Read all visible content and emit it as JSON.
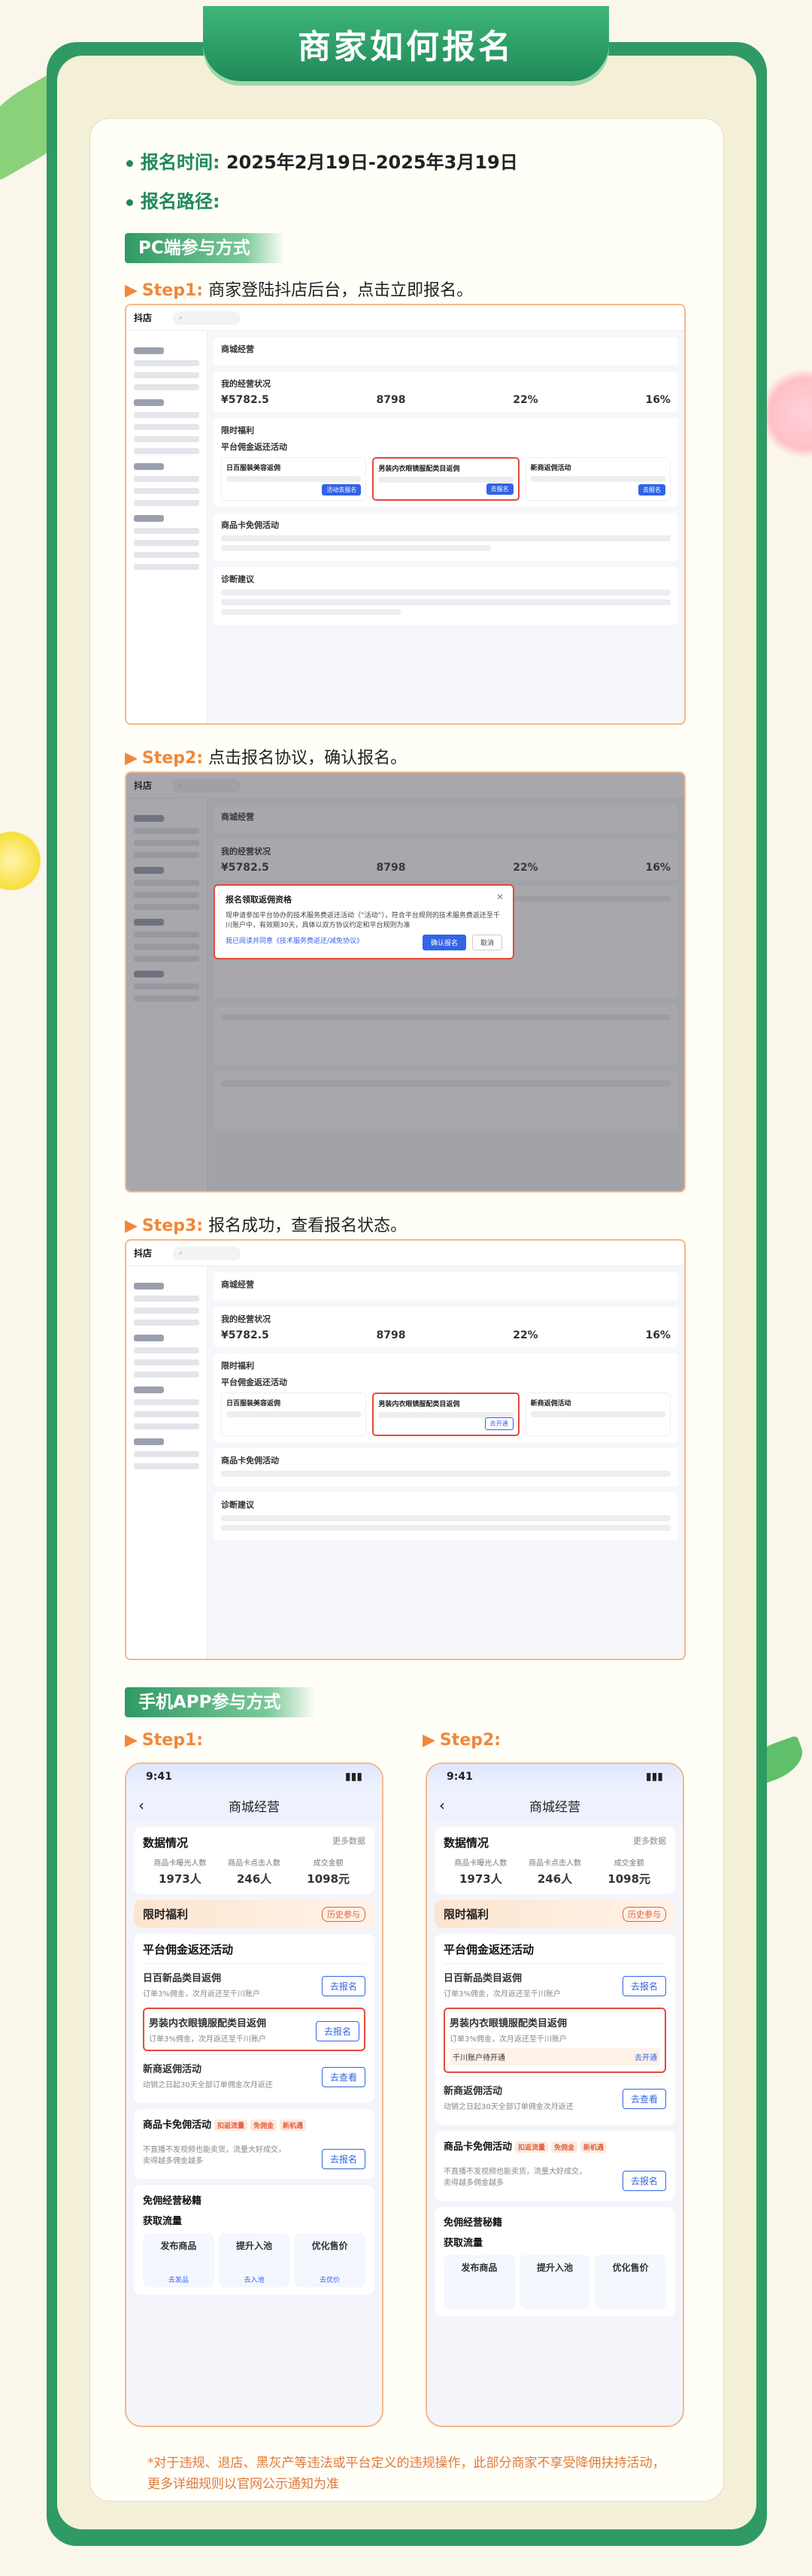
{
  "title": "商家如何报名",
  "info": {
    "time_label": "报名时间:",
    "time_value": "2025年2月19日-2025年3月19日",
    "path_label": "报名路径:"
  },
  "pc": {
    "tag": "PC端参与方式",
    "steps": [
      {
        "label": "Step1:",
        "text": "商家登陆抖店后台，点击立即报名。"
      },
      {
        "label": "Step2:",
        "text": "点击报名协议，确认报名。"
      },
      {
        "label": "Step3:",
        "text": "报名成功，查看报名状态。"
      }
    ],
    "screen": {
      "logo": "抖店",
      "page_title": "商城经营",
      "card1_title": "我的经营状况",
      "kpis": [
        "¥5782.5",
        "8798",
        "22%",
        "16%"
      ],
      "card2_title": "限时福利",
      "sub_title": "平台佣金返还活动",
      "activities": [
        {
          "name": "日百服装美容返佣",
          "btn": "活动去报名"
        },
        {
          "name": "男装内衣眼镜服配类目返佣",
          "btn": "去报名"
        },
        {
          "name": "新商返佣活动",
          "btn": "去报名"
        }
      ],
      "card3_title": "商品卡免佣活动",
      "card4_title": "诊断建议"
    },
    "modal": {
      "title": "报名领取返佣资格",
      "body": "现申请参加平台协办的技术服务费返还活动（“活动”），符合平台规则的技术服务费返还至千川账户中，有效期30天，具体以双方协议约定和平台规则为准",
      "agree": "我已阅读并同意《技术服务费返还/减免协议》",
      "ok": "确认报名",
      "cancel": "取消"
    }
  },
  "app": {
    "tag": "手机APP参与方式",
    "step1": "Step1:",
    "step2": "Step2:",
    "time": "9:41",
    "nav_title": "商城经营",
    "stats_title": "数据情况",
    "stats_more": "更多数据",
    "stats": [
      {
        "label": "商品卡曝光人数",
        "value": "1973人"
      },
      {
        "label": "商品卡点击人数",
        "value": "246人"
      },
      {
        "label": "成交金额",
        "value": "1098元"
      }
    ],
    "welfare": "限时福利",
    "history": "历史参与",
    "section": "平台佣金返还活动",
    "items": [
      {
        "name": "日百新品类目返佣",
        "desc": "订单3%佣金，次月返还至千川账户",
        "btn": "去报名"
      },
      {
        "name": "男装内衣眼镜服配类目返佣",
        "desc": "订单3%佣金，次月返还至千川账户",
        "btn": "去报名"
      },
      {
        "name": "新商返佣活动",
        "desc": "动销之日起30天全部订单佣金次月返还",
        "btn": "去查看"
      }
    ],
    "step2_hint": "千川账户待开通",
    "step2_link": "去开通",
    "free_title": "商品卡免佣活动",
    "free_tags": [
      "扣返流量",
      "免佣金",
      "新机遇"
    ],
    "free_desc": "不直播不发视频也能卖货，流量大好成交，卖得越多佣金越多",
    "free_btn": "去报名",
    "secret": "免佣经营秘籍",
    "flow_title": "获取流量",
    "flow": [
      {
        "name": "发布商品",
        "link": "去发品"
      },
      {
        "name": "提升入池",
        "link": "去入池"
      },
      {
        "name": "优化售价",
        "link": "去优价"
      }
    ]
  },
  "note": "*对于违规、退店、黑灰产等违法或平台定义的违规操作，此部分商家不享受降佣扶持活动，更多详细规则以官网公示通知为准"
}
